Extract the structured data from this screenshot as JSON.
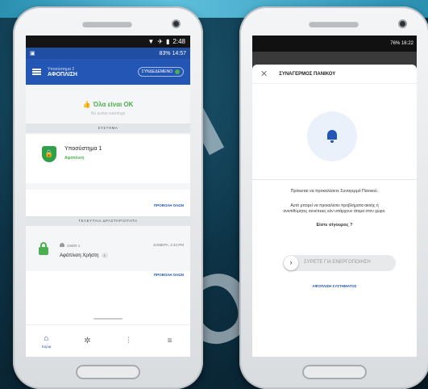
{
  "background": {
    "watermark_top": "Oh",
    "watermark_bottom": "ION"
  },
  "left_phone": {
    "system_time": "2:48",
    "app_status": {
      "signal": "83%",
      "time": "14:57"
    },
    "header": {
      "subtitle": "Υποσύστημα 2",
      "title": "ΑΦΟΠΛΙΣΗ",
      "connection": "ΣΥΝΔΕΔΕΜΕΝΟ"
    },
    "ok_message": "Όλα είναι ΟΚ",
    "no_warnings": "No active warnings",
    "section_system": "ΣΥΣΤΗΜΑ",
    "subsystem": {
      "name": "Υποσύστημα 1",
      "state": "Αφόπλιση"
    },
    "view_all_1": "ΠΡΟΒΟΛΗ ΟΛΩΝ",
    "section_events": "ΤΕΛΕΥΤΑΙΑ ΔΡΑΣΤΗΡΙΟΤΗΤΑ",
    "event": {
      "user": "USER 1",
      "time": "ΣΗΜΕΡΑ, 2:44 PM",
      "text": "Αφόπλιση Χρήστη",
      "badge": "1"
    },
    "view_all_2": "ΠΡΟΒΟΛΗ ΟΛΩΝ",
    "nav": [
      {
        "label": "Κύρια",
        "icon": "home-icon"
      },
      {
        "label": "",
        "icon": "network-icon"
      },
      {
        "label": "",
        "icon": "sliders-icon"
      },
      {
        "label": "",
        "icon": "list-icon"
      }
    ],
    "colors": {
      "primary": "#2356b5",
      "ok": "#4caf50"
    }
  },
  "right_phone": {
    "status": "76% 16:22",
    "title": "ΣΥΝΑΓΕΡΜΟΣ ΠΑΝΙΚΟΥ",
    "message1": "Πρόκειται να προκαλέσετε Συναγερμό Πανικού.",
    "message2a": "Αυτό μπορεί να προκαλέσει προβλήματα ακοής ή",
    "message2b": "ανεπιθύμητες συνέπειες εάν υπάρχουν άτομα στον χώρο.",
    "question": "Είστε σίγουρος ?",
    "slider_label": "ΣΥΡΕΤΕ ΓΙΑ ΕΝΕΡΓΟΠΟΙΗΣΗ",
    "disarm_link": "ΑΦΟΠΛΙΣΗ ΣΥΣΤΗΜΑΤΟΣ"
  }
}
